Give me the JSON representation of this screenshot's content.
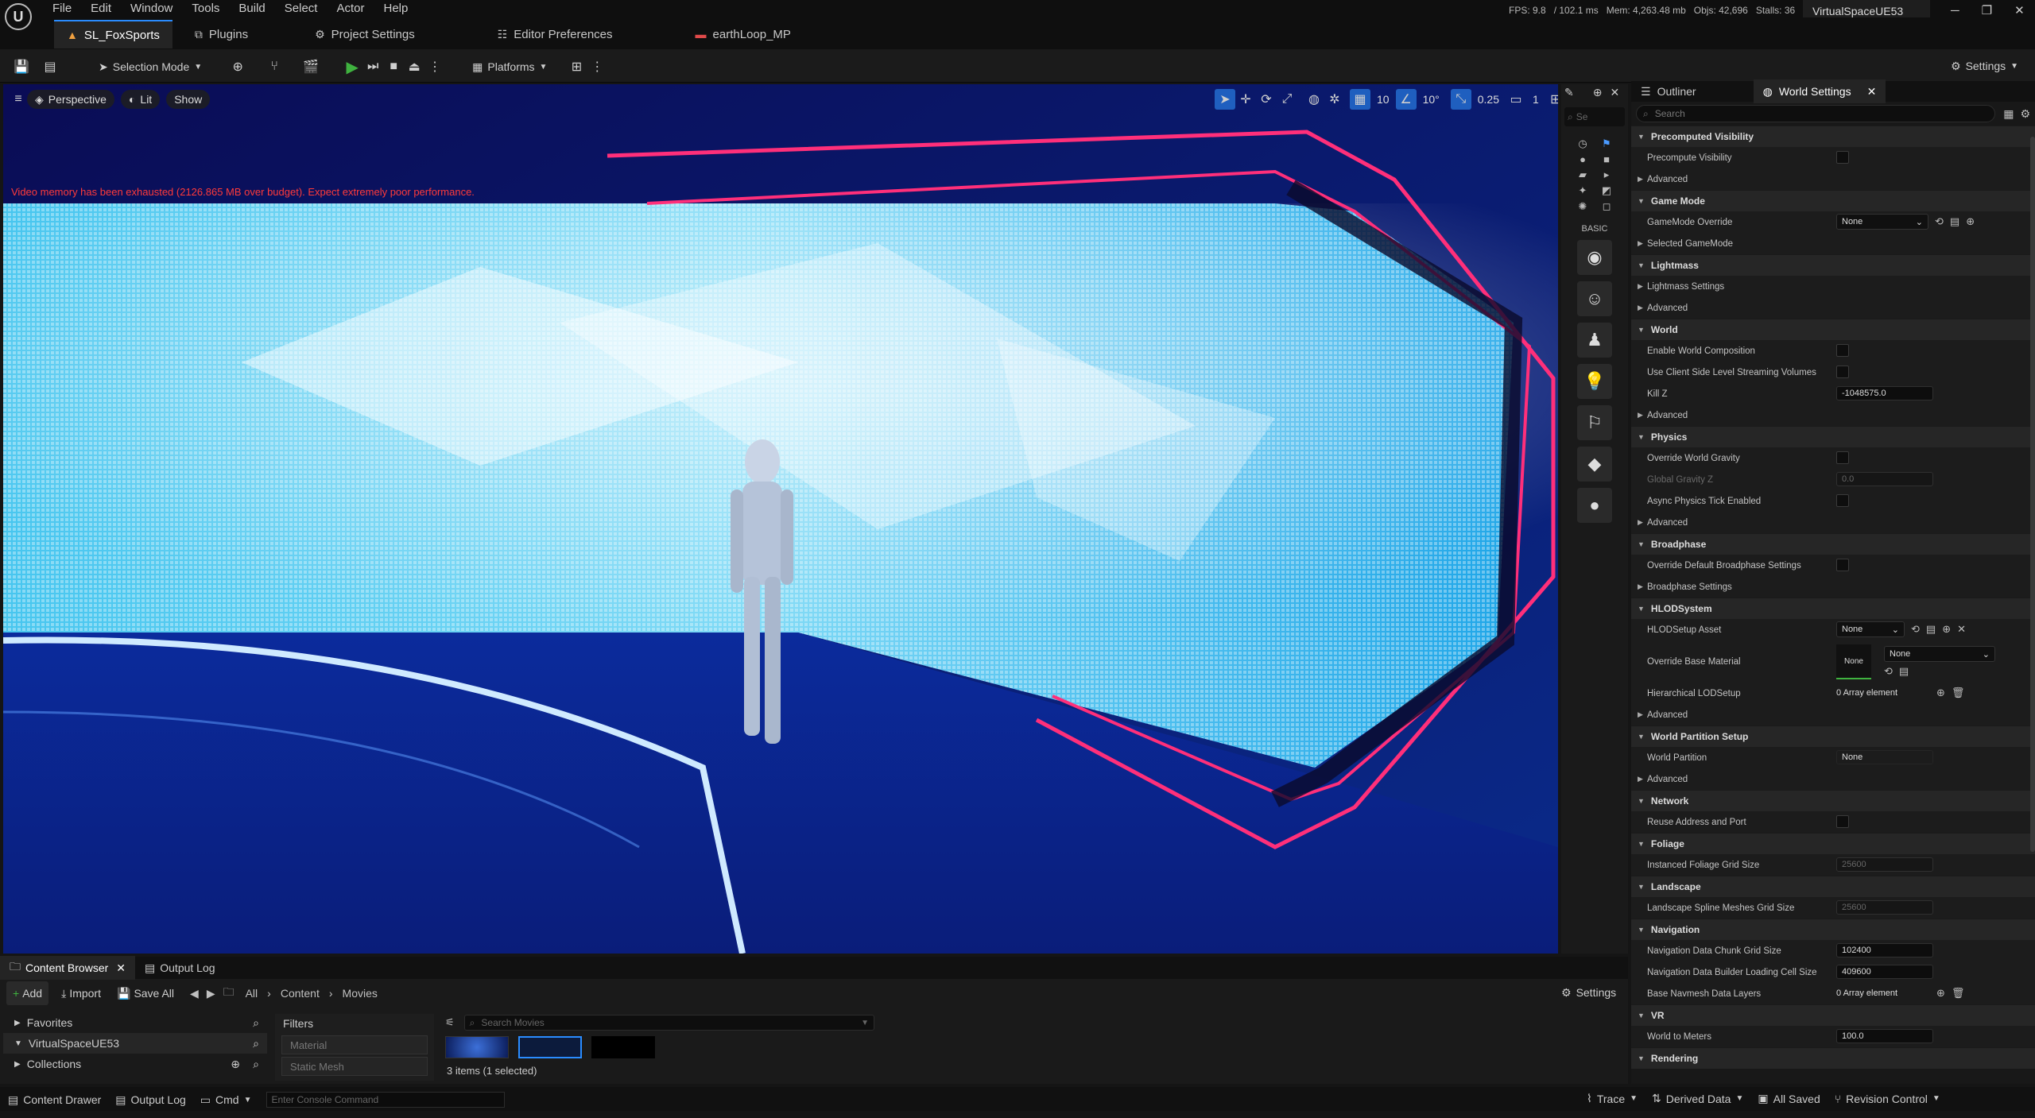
{
  "menu": {
    "items": [
      "File",
      "Edit",
      "Window",
      "Tools",
      "Build",
      "Select",
      "Actor",
      "Help"
    ]
  },
  "stats": {
    "fps": "FPS: 9.8",
    "frame": "/ 102.1 ms",
    "mem": "Mem: 4,263.48 mb",
    "objs": "Objs: 42,696",
    "stalls": "Stalls: 36"
  },
  "project_name": "VirtualSpaceUE53",
  "tabs": [
    {
      "label": "SL_FoxSports",
      "icon": "level-icon",
      "active": true
    },
    {
      "label": "Plugins",
      "icon": "plugin-icon"
    },
    {
      "label": "Project Settings",
      "icon": "gear-icon"
    },
    {
      "label": "Editor Preferences",
      "icon": "sliders-icon"
    },
    {
      "label": "earthLoop_MP",
      "icon": "media-player-icon"
    }
  ],
  "toolbar": {
    "selection_mode": "Selection Mode",
    "platforms": "Platforms",
    "settings": "Settings"
  },
  "viewport": {
    "perspective": "Perspective",
    "lit": "Lit",
    "show": "Show",
    "warning": "Video memory has been exhausted (2126.865 MB over budget). Expect extremely poor performance.",
    "grid_snap": "10",
    "rot_snap": "10°",
    "scale_snap": "0.25",
    "camera_speed": "1",
    "warning_color": "#ff3a3a"
  },
  "modes": {
    "search_placeholder": "Se",
    "basic_label": "BASIC"
  },
  "details": {
    "tab_outliner": "Outliner",
    "tab_world": "World Settings",
    "search_placeholder": "Search",
    "rows": [
      {
        "type": "section",
        "label": "Precomputed Visibility"
      },
      {
        "type": "prop",
        "label": "Precompute Visibility",
        "ctl": "chk"
      },
      {
        "type": "adv",
        "label": "Advanced"
      },
      {
        "type": "section",
        "label": "Game Mode"
      },
      {
        "type": "prop",
        "label": "GameMode Override",
        "ctl": "dd",
        "value": "None"
      },
      {
        "type": "adv",
        "label": "Selected GameMode"
      },
      {
        "type": "section",
        "label": "Lightmass"
      },
      {
        "type": "adv",
        "label": "Lightmass Settings"
      },
      {
        "type": "adv",
        "label": "Advanced"
      },
      {
        "type": "section",
        "label": "World"
      },
      {
        "type": "prop",
        "label": "Enable World Composition",
        "ctl": "chk"
      },
      {
        "type": "prop",
        "label": "Use Client Side Level Streaming Volumes",
        "ctl": "chk"
      },
      {
        "type": "prop",
        "label": "Kill Z",
        "ctl": "inp",
        "value": "-1048575.0"
      },
      {
        "type": "adv",
        "label": "Advanced"
      },
      {
        "type": "section",
        "label": "Physics"
      },
      {
        "type": "prop",
        "label": "Override World Gravity",
        "ctl": "chk"
      },
      {
        "type": "prop",
        "label": "Global Gravity Z",
        "ctl": "inpdim",
        "value": "0.0",
        "dim": true
      },
      {
        "type": "prop",
        "label": "Async Physics Tick Enabled",
        "ctl": "chk"
      },
      {
        "type": "adv",
        "label": "Advanced"
      },
      {
        "type": "section",
        "label": "Broadphase"
      },
      {
        "type": "prop",
        "label": "Override Default Broadphase Settings",
        "ctl": "chk"
      },
      {
        "type": "adv",
        "label": "Broadphase Settings"
      },
      {
        "type": "section",
        "label": "HLODSystem"
      },
      {
        "type": "prop",
        "label": "HLODSetup Asset",
        "ctl": "dd2",
        "value": "None"
      },
      {
        "type": "material",
        "label": "Override Base Material",
        "value": "None",
        "thumb": "None"
      },
      {
        "type": "prop",
        "label": "Hierarchical LODSetup",
        "ctl": "arr",
        "value": "0 Array element"
      },
      {
        "type": "adv",
        "label": "Advanced"
      },
      {
        "type": "section",
        "label": "World Partition Setup"
      },
      {
        "type": "prop",
        "label": "World Partition",
        "ctl": "txt",
        "value": "None"
      },
      {
        "type": "adv",
        "label": "Advanced"
      },
      {
        "type": "section",
        "label": "Network"
      },
      {
        "type": "prop",
        "label": "Reuse Address and Port",
        "ctl": "chk"
      },
      {
        "type": "section",
        "label": "Foliage"
      },
      {
        "type": "prop",
        "label": "Instanced Foliage Grid Size",
        "ctl": "inpdim",
        "value": "25600"
      },
      {
        "type": "section",
        "label": "Landscape"
      },
      {
        "type": "prop",
        "label": "Landscape Spline Meshes Grid Size",
        "ctl": "inpdim",
        "value": "25600"
      },
      {
        "type": "section",
        "label": "Navigation"
      },
      {
        "type": "prop",
        "label": "Navigation Data Chunk Grid Size",
        "ctl": "inp",
        "value": "102400"
      },
      {
        "type": "prop",
        "label": "Navigation Data Builder Loading Cell Size",
        "ctl": "inp",
        "value": "409600"
      },
      {
        "type": "prop",
        "label": "Base Navmesh Data Layers",
        "ctl": "arr",
        "value": "0 Array element"
      },
      {
        "type": "section",
        "label": "VR"
      },
      {
        "type": "prop",
        "label": "World to Meters",
        "ctl": "inp",
        "value": "100.0"
      },
      {
        "type": "section",
        "label": "Rendering"
      }
    ]
  },
  "content_browser": {
    "tab_cb": "Content Browser",
    "tab_log": "Output Log",
    "add": "Add",
    "import": "Import",
    "save_all": "Save All",
    "path": [
      "All",
      "Content",
      "Movies"
    ],
    "settings": "Settings",
    "favorites": "Favorites",
    "project": "VirtualSpaceUE53",
    "collections": "Collections",
    "filters": "Filters",
    "filter_items": [
      "Material",
      "Static Mesh"
    ],
    "search_placeholder": "Search Movies",
    "count": "3 items (1 selected)"
  },
  "status": {
    "drawer": "Content Drawer",
    "log": "Output Log",
    "cmd": "Cmd",
    "console_placeholder": "Enter Console Command",
    "trace": "Trace",
    "derived": "Derived Data",
    "saved": "All Saved",
    "rc": "Revision Control"
  },
  "colors": {
    "accent": "#2a8cff",
    "play": "#3fb23f"
  }
}
